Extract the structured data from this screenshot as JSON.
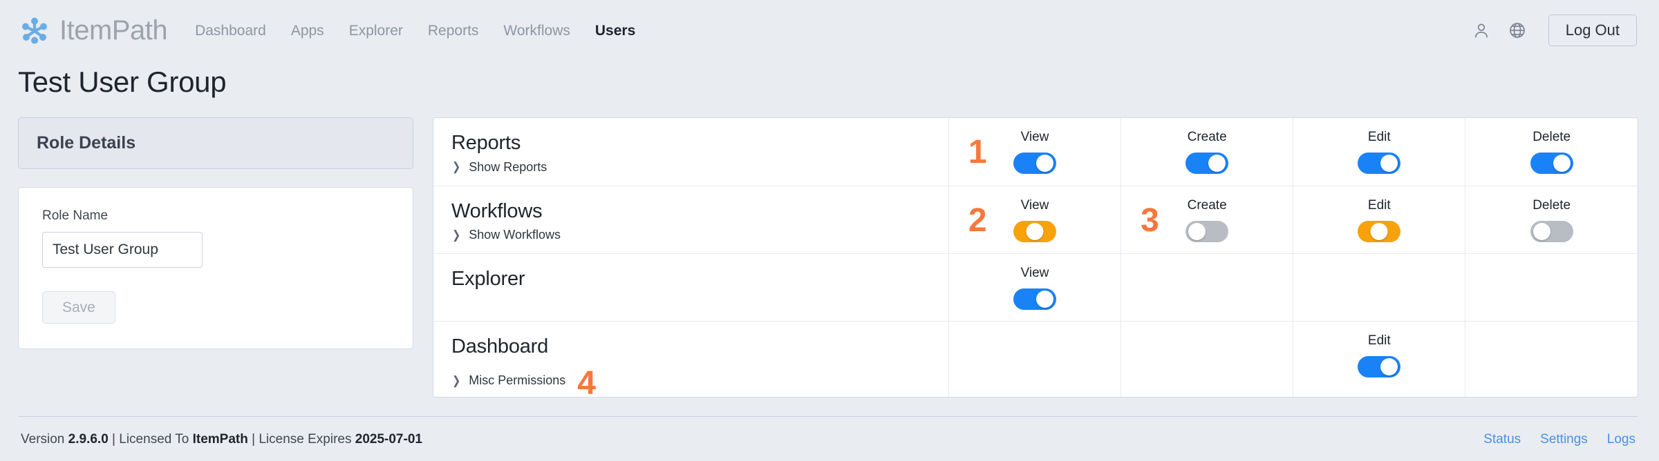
{
  "nav": {
    "brand_name": "ItemPath",
    "brand_icon": "itempath-node-cluster-logo",
    "links": [
      {
        "label": "Dashboard",
        "active": false
      },
      {
        "label": "Apps",
        "active": false
      },
      {
        "label": "Explorer",
        "active": false
      },
      {
        "label": "Reports",
        "active": false
      },
      {
        "label": "Workflows",
        "active": false
      },
      {
        "label": "Users",
        "active": true
      }
    ],
    "account_icon": "user-icon",
    "language_icon": "globe-icon",
    "logout_label": "Log Out"
  },
  "page": {
    "title": "Test User Group"
  },
  "role_details": {
    "panel_title": "Role Details",
    "role_name_label": "Role Name",
    "role_name_value": "Test User Group",
    "role_name_placeholder": "Role Name",
    "save_label": "Save",
    "save_disabled": true
  },
  "permissions": {
    "rows": [
      {
        "module": "Reports",
        "sub_label": "Show Reports",
        "annotation": "1",
        "annotation_placement": "perm-view",
        "cells": [
          {
            "label": "View",
            "state": "on"
          },
          {
            "label": "Create",
            "state": "on"
          },
          {
            "label": "Edit",
            "state": "on"
          },
          {
            "label": "Delete",
            "state": "on"
          }
        ]
      },
      {
        "module": "Workflows",
        "sub_label": "Show Workflows",
        "annotation": "2",
        "annotation_placement": "perm-view",
        "annotation2": "3",
        "annotation2_placement": "perm-create",
        "cells": [
          {
            "label": "View",
            "state": "partial"
          },
          {
            "label": "Create",
            "state": "off"
          },
          {
            "label": "Edit",
            "state": "partial"
          },
          {
            "label": "Delete",
            "state": "off"
          }
        ]
      },
      {
        "module": "Explorer",
        "sub_label": "",
        "cells": [
          {
            "label": "View",
            "state": "on"
          },
          {
            "label": "",
            "state": ""
          },
          {
            "label": "",
            "state": ""
          },
          {
            "label": "",
            "state": ""
          }
        ]
      },
      {
        "module": "Dashboard",
        "sub_label": "Misc Permissions",
        "annotation": "4",
        "annotation_placement": "inline-sub",
        "cells": [
          {
            "label": "",
            "state": ""
          },
          {
            "label": "",
            "state": ""
          },
          {
            "label": "Edit",
            "state": "on"
          },
          {
            "label": "",
            "state": ""
          }
        ]
      }
    ]
  },
  "footer": {
    "version_prefix": "Version",
    "version": "2.9.6.0",
    "licensed_prefix": "Licensed To",
    "licensed_to": "ItemPath",
    "expires_prefix": "License Expires",
    "expires": "2025-07-01",
    "separator": "|",
    "links": [
      {
        "label": "Status"
      },
      {
        "label": "Settings"
      },
      {
        "label": "Logs"
      }
    ]
  },
  "colors": {
    "page_background": "#e9ecf1",
    "toggle_on": "#1a82f7",
    "toggle_partial": "#f7a20a",
    "toggle_off": "#b8bcc3",
    "annotation": "#f7783c",
    "link": "#4a90e6"
  }
}
